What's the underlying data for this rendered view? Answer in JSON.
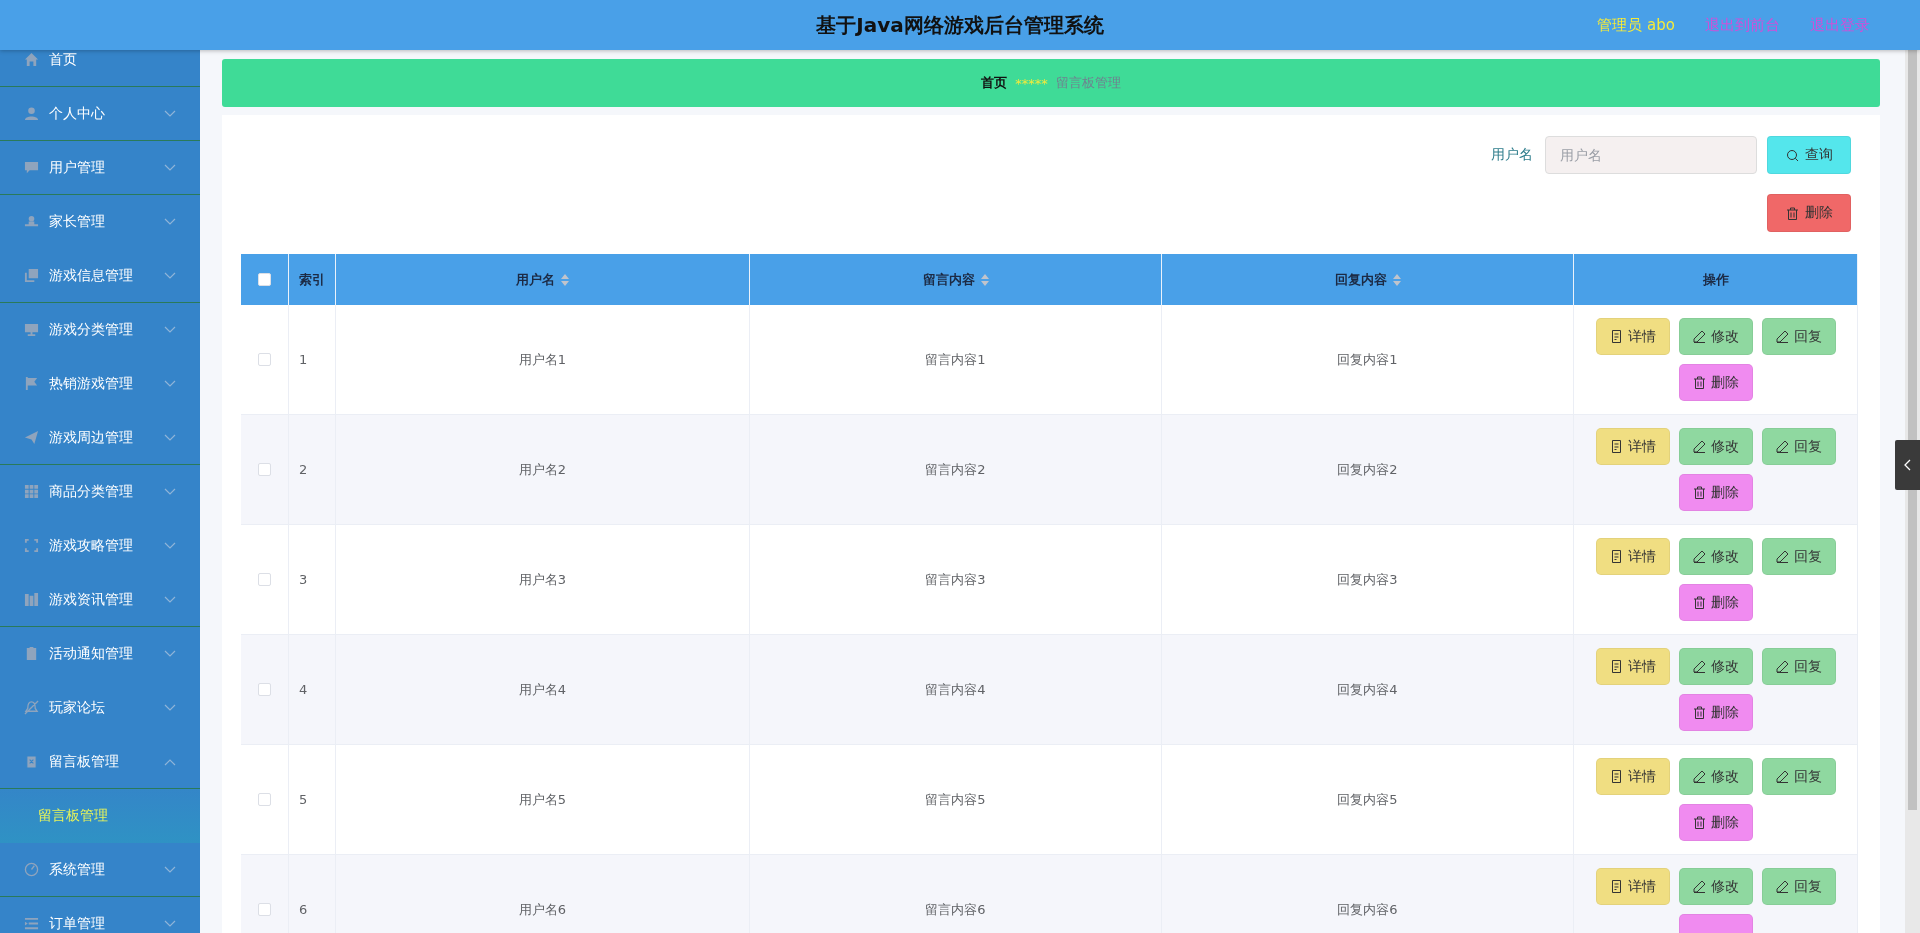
{
  "header": {
    "title": "基于Java网络游戏后台管理系统",
    "user": "管理员 abo",
    "links": [
      "退出到前台",
      "退出登录"
    ]
  },
  "sidebar": {
    "items": [
      {
        "kind": "link",
        "label": "首页"
      },
      {
        "kind": "menu",
        "label": "个人中心",
        "expanded": false
      },
      {
        "kind": "menu",
        "label": "用户管理",
        "expanded": false
      },
      {
        "kind": "menu",
        "label": "家长管理",
        "expanded": false
      },
      {
        "kind": "menu",
        "label": "游戏信息管理",
        "expanded": false
      },
      {
        "kind": "menu",
        "label": "游戏分类管理",
        "expanded": false
      },
      {
        "kind": "menu",
        "label": "热销游戏管理",
        "expanded": false
      },
      {
        "kind": "menu",
        "label": "游戏周边管理",
        "expanded": false
      },
      {
        "kind": "menu",
        "label": "商品分类管理",
        "expanded": false
      },
      {
        "kind": "menu",
        "label": "游戏攻略管理",
        "expanded": false
      },
      {
        "kind": "menu",
        "label": "游戏资讯管理",
        "expanded": false
      },
      {
        "kind": "menu",
        "label": "活动通知管理",
        "expanded": false
      },
      {
        "kind": "menu",
        "label": "玩家论坛",
        "expanded": false
      },
      {
        "kind": "menu",
        "label": "留言板管理",
        "expanded": true,
        "children": [
          {
            "label": "留言板管理",
            "selected": true
          }
        ]
      },
      {
        "kind": "menu",
        "label": "系统管理",
        "expanded": false
      },
      {
        "kind": "menu",
        "label": "订单管理",
        "expanded": false
      }
    ]
  },
  "breadcrumb": {
    "home": "首页",
    "separator": "*****",
    "current": "留言板管理"
  },
  "search": {
    "label": "用户名",
    "placeholder": "用户名",
    "button": "查询"
  },
  "toolbar": {
    "delete_button": "删除"
  },
  "table": {
    "select_all_checked": false,
    "columns": [
      {
        "label": "索引",
        "sortable": false
      },
      {
        "label": "用户名",
        "sortable": true
      },
      {
        "label": "留言内容",
        "sortable": true
      },
      {
        "label": "回复内容",
        "sortable": true
      },
      {
        "label": "操作",
        "sortable": false
      }
    ],
    "rows": [
      {
        "checked": false,
        "cells": [
          "1",
          "用户名1",
          "留言内容1",
          "回复内容1"
        ],
        "actions": [
          {
            "kind": "detail",
            "label": "详情"
          },
          {
            "kind": "edit",
            "label": "修改"
          },
          {
            "kind": "edit",
            "label": "回复"
          },
          {
            "kind": "delete",
            "label": "删除"
          }
        ]
      },
      {
        "checked": false,
        "cells": [
          "2",
          "用户名2",
          "留言内容2",
          "回复内容2"
        ],
        "actions": [
          {
            "kind": "detail",
            "label": "详情"
          },
          {
            "kind": "edit",
            "label": "修改"
          },
          {
            "kind": "edit",
            "label": "回复"
          },
          {
            "kind": "delete",
            "label": "删除"
          }
        ]
      },
      {
        "checked": false,
        "cells": [
          "3",
          "用户名3",
          "留言内容3",
          "回复内容3"
        ],
        "actions": [
          {
            "kind": "detail",
            "label": "详情"
          },
          {
            "kind": "edit",
            "label": "修改"
          },
          {
            "kind": "edit",
            "label": "回复"
          },
          {
            "kind": "delete",
            "label": "删除"
          }
        ]
      },
      {
        "checked": false,
        "cells": [
          "4",
          "用户名4",
          "留言内容4",
          "回复内容4"
        ],
        "actions": [
          {
            "kind": "detail",
            "label": "详情"
          },
          {
            "kind": "edit",
            "label": "修改"
          },
          {
            "kind": "edit",
            "label": "回复"
          },
          {
            "kind": "delete",
            "label": "删除"
          }
        ]
      },
      {
        "checked": false,
        "cells": [
          "5",
          "用户名5",
          "留言内容5",
          "回复内容5"
        ],
        "actions": [
          {
            "kind": "detail",
            "label": "详情"
          },
          {
            "kind": "edit",
            "label": "修改"
          },
          {
            "kind": "edit",
            "label": "回复"
          },
          {
            "kind": "delete",
            "label": "删除"
          }
        ]
      },
      {
        "checked": false,
        "cells": [
          "6",
          "用户名6",
          "留言内容6",
          "回复内容6"
        ],
        "actions": [
          {
            "kind": "detail",
            "label": "详情"
          },
          {
            "kind": "edit",
            "label": "修改"
          },
          {
            "kind": "edit",
            "label": "回复"
          },
          {
            "kind": "delete"
          }
        ]
      }
    ]
  }
}
